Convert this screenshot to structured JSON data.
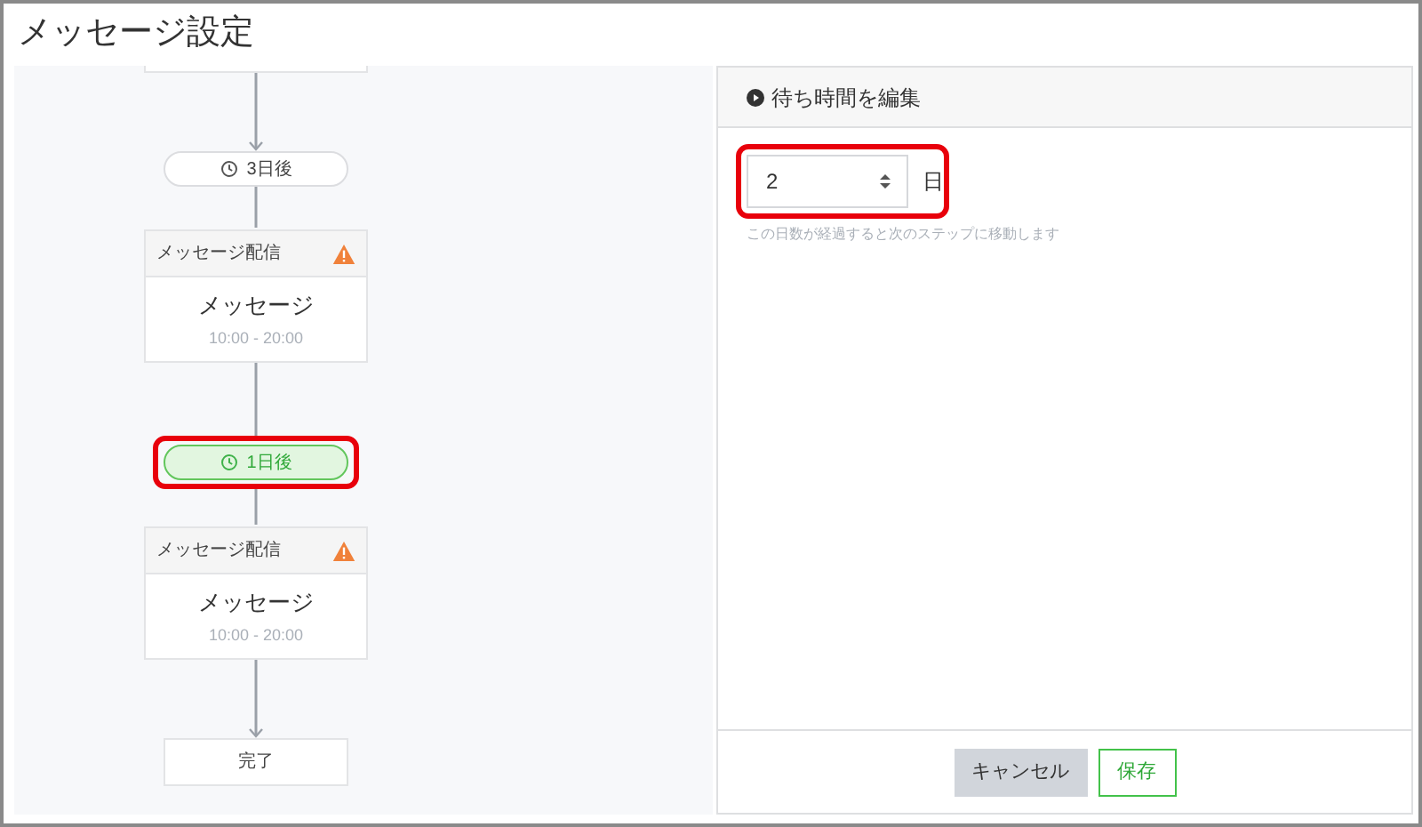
{
  "title": "メッセージ設定",
  "flow": [
    {
      "kind": "cut_card"
    },
    {
      "kind": "wait",
      "label": "3日後",
      "selected": false,
      "highlighted": false
    },
    {
      "kind": "message",
      "header": "メッセージ配信",
      "warning": true,
      "title": "メッセージ",
      "time": "10:00 - 20:00"
    },
    {
      "kind": "wait",
      "label": "1日後",
      "selected": true,
      "highlighted": true
    },
    {
      "kind": "message",
      "header": "メッセージ配信",
      "warning": true,
      "title": "メッセージ",
      "time": "10:00 - 20:00"
    },
    {
      "kind": "end",
      "label": "完了"
    }
  ],
  "editor": {
    "title": "待ち時間を編集",
    "value": "2",
    "unit": "日",
    "highlighted": true,
    "hint": "この日数が経過すると次のステップに移動します"
  },
  "buttons": [
    {
      "kind": "cancel",
      "label": "キャンセル"
    },
    {
      "kind": "save",
      "label": "保存"
    }
  ]
}
